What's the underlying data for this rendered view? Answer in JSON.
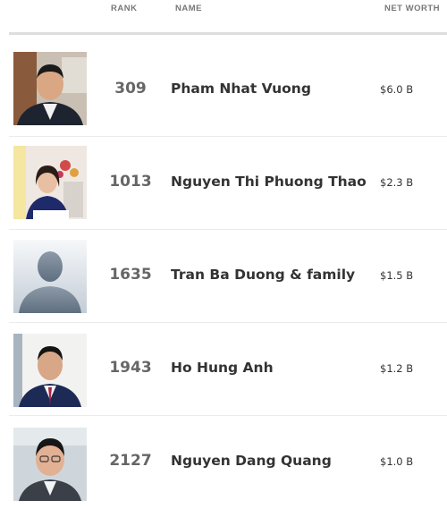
{
  "header": {
    "rank_label": "RANK",
    "name_label": "NAME",
    "net_worth_label": "NET WORTH"
  },
  "rows": [
    {
      "rank": "309",
      "name": "Pham Nhat Vuong",
      "net_worth": "$6.0 B",
      "photo": "portrait-photo"
    },
    {
      "rank": "1013",
      "name": "Nguyen Thi Phuong Thao",
      "net_worth": "$2.3 B",
      "photo": "portrait-photo"
    },
    {
      "rank": "1635",
      "name": "Tran Ba Duong & family",
      "net_worth": "$1.5 B",
      "photo": "placeholder-silhouette"
    },
    {
      "rank": "1943",
      "name": "Ho Hung Anh",
      "net_worth": "$1.2 B",
      "photo": "portrait-photo"
    },
    {
      "rank": "2127",
      "name": "Nguyen Dang Quang",
      "net_worth": "$1.0 B",
      "photo": "portrait-photo"
    }
  ],
  "colors": {
    "rank_text": "#666666",
    "name_text": "#333333",
    "header_text": "#777777",
    "divider": "#ececec"
  }
}
